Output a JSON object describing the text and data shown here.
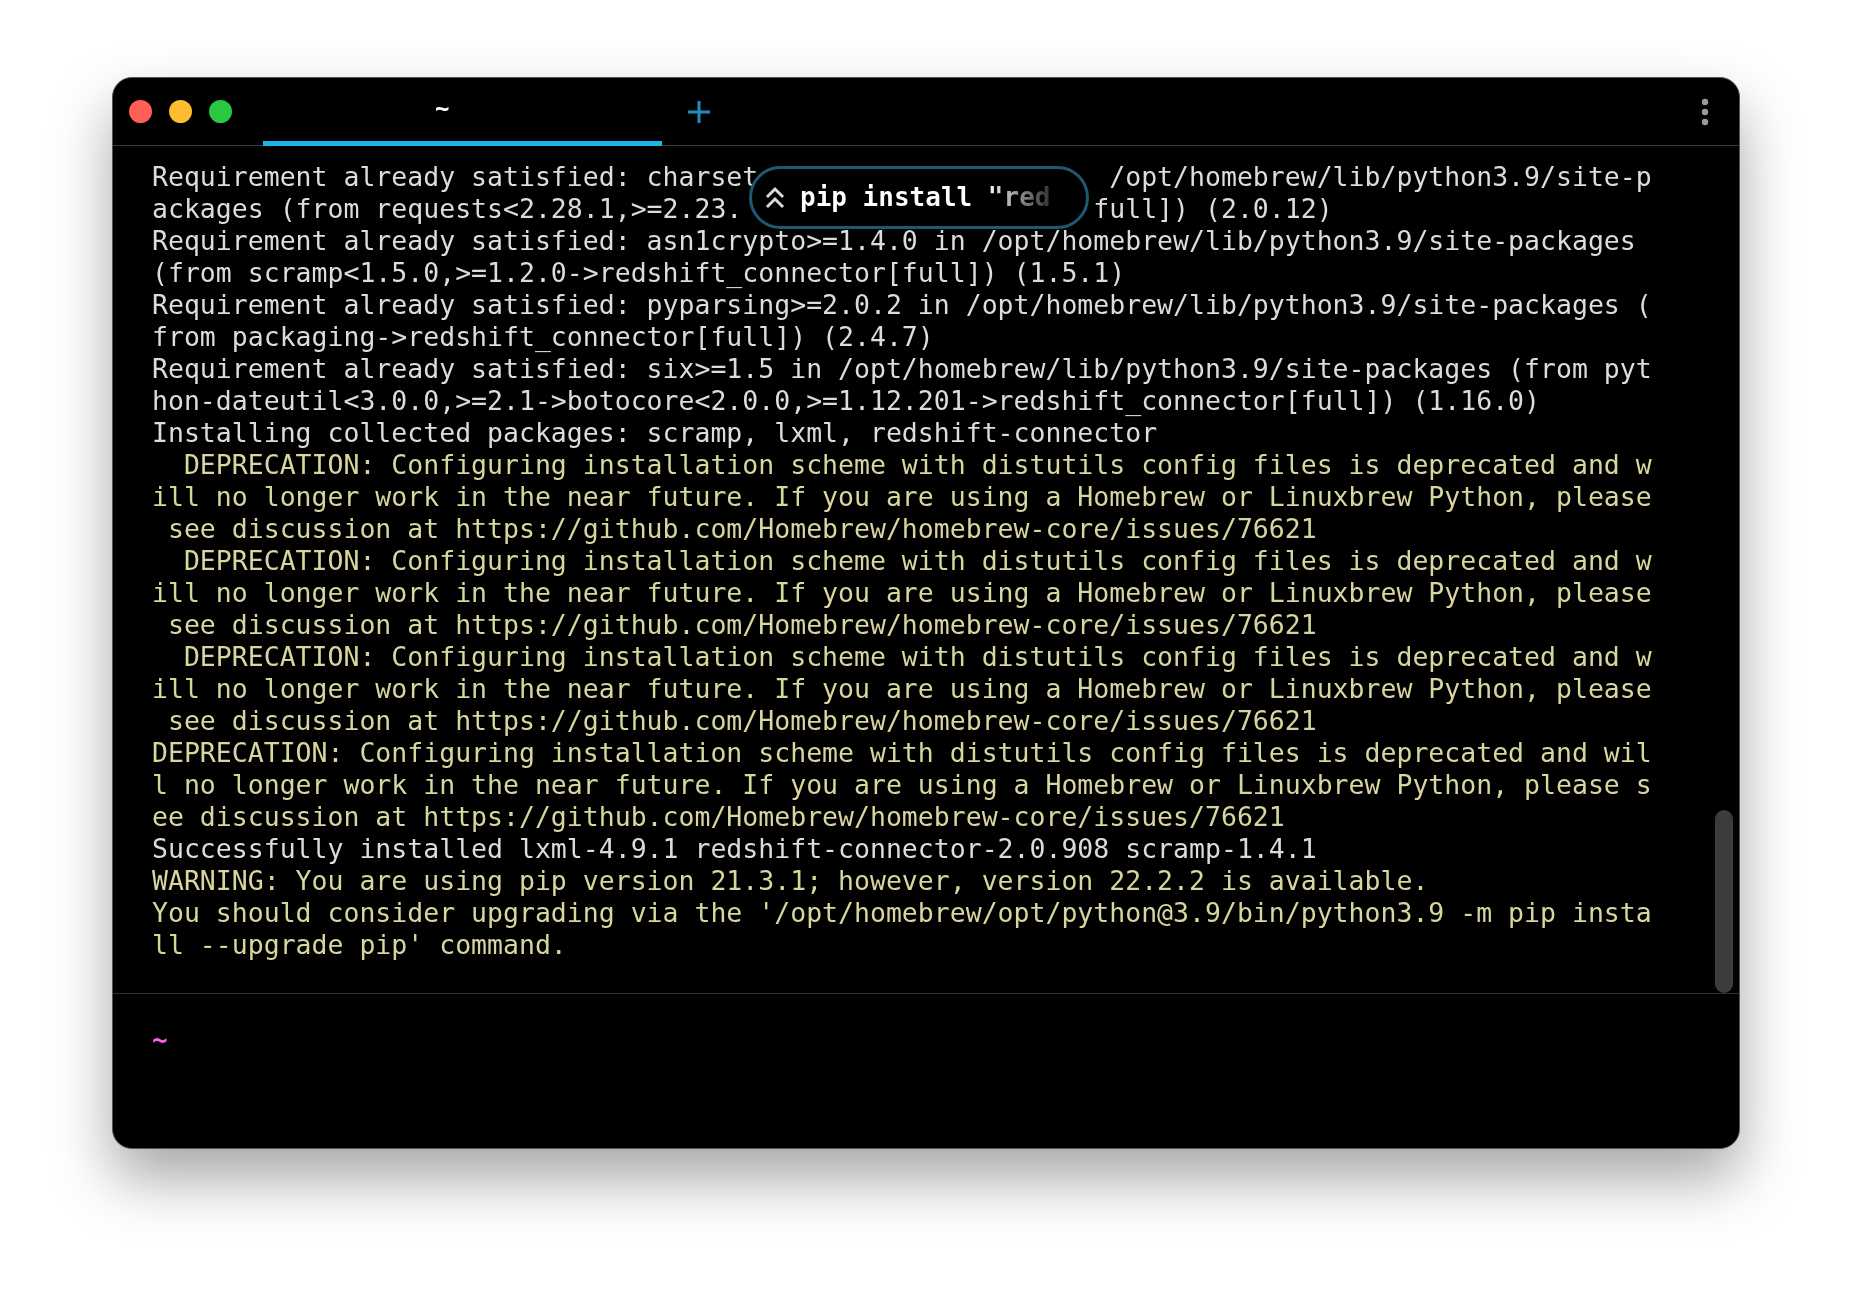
{
  "tab": {
    "title": "~",
    "selected": true
  },
  "output_lines": [
    {
      "kind": "normal",
      "parts": [
        "Requirement already satisfied: charset",
        "/opt/homebrew/lib/python3.9/site-p"
      ]
    },
    {
      "kind": "normal",
      "parts": [
        "ackages (from requests<2.28.1,>=2.23.",
        "full]) (2.0.12)"
      ]
    },
    {
      "kind": "normal",
      "parts": [
        "Requirement already satisfied: asn1crypto>=1.4.0 in /opt/homebrew/lib/python3.9/site-packages"
      ]
    },
    {
      "kind": "normal",
      "parts": [
        "(from scramp<1.5.0,>=1.2.0->redshift_connector[full]) (1.5.1)"
      ]
    },
    {
      "kind": "normal",
      "parts": [
        "Requirement already satisfied: pyparsing>=2.0.2 in /opt/homebrew/lib/python3.9/site-packages ("
      ]
    },
    {
      "kind": "normal",
      "parts": [
        "from packaging->redshift_connector[full]) (2.4.7)"
      ]
    },
    {
      "kind": "normal",
      "parts": [
        "Requirement already satisfied: six>=1.5 in /opt/homebrew/lib/python3.9/site-packages (from pyt"
      ]
    },
    {
      "kind": "normal",
      "parts": [
        "hon-dateutil<3.0.0,>=2.1->botocore<2.0.0,>=1.12.201->redshift_connector[full]) (1.16.0)"
      ]
    },
    {
      "kind": "normal",
      "parts": [
        "Installing collected packages: scramp, lxml, redshift-connector"
      ]
    },
    {
      "kind": "warning",
      "parts": [
        "  DEPRECATION: Configuring installation scheme with distutils config files is deprecated and w"
      ]
    },
    {
      "kind": "warning",
      "parts": [
        "ill no longer work in the near future. If you are using a Homebrew or Linuxbrew Python, please"
      ]
    },
    {
      "kind": "warning",
      "parts": [
        " see discussion at https://github.com/Homebrew/homebrew-core/issues/76621"
      ]
    },
    {
      "kind": "warning",
      "parts": [
        "  DEPRECATION: Configuring installation scheme with distutils config files is deprecated and w"
      ]
    },
    {
      "kind": "warning",
      "parts": [
        "ill no longer work in the near future. If you are using a Homebrew or Linuxbrew Python, please"
      ]
    },
    {
      "kind": "warning",
      "parts": [
        " see discussion at https://github.com/Homebrew/homebrew-core/issues/76621"
      ]
    },
    {
      "kind": "warning",
      "parts": [
        "  DEPRECATION: Configuring installation scheme with distutils config files is deprecated and w"
      ]
    },
    {
      "kind": "warning",
      "parts": [
        "ill no longer work in the near future. If you are using a Homebrew or Linuxbrew Python, please"
      ]
    },
    {
      "kind": "warning",
      "parts": [
        " see discussion at https://github.com/Homebrew/homebrew-core/issues/76621"
      ]
    },
    {
      "kind": "warning",
      "parts": [
        "DEPRECATION: Configuring installation scheme with distutils config files is deprecated and wil"
      ]
    },
    {
      "kind": "warning",
      "parts": [
        "l no longer work in the near future. If you are using a Homebrew or Linuxbrew Python, please s"
      ]
    },
    {
      "kind": "warning",
      "parts": [
        "ee discussion at https://github.com/Homebrew/homebrew-core/issues/76621"
      ]
    },
    {
      "kind": "normal",
      "parts": [
        "Successfully installed lxml-4.9.1 redshift-connector-2.0.908 scramp-1.4.1"
      ]
    },
    {
      "kind": "warning",
      "parts": [
        "WARNING: You are using pip version 21.3.1; however, version 22.2.2 is available."
      ]
    },
    {
      "kind": "warning",
      "parts": [
        "You should consider upgrading via the '/opt/homebrew/opt/python@3.9/bin/python3.9 -m pip insta"
      ]
    },
    {
      "kind": "warning",
      "parts": [
        "ll --upgrade pip' command."
      ]
    }
  ],
  "overlay": {
    "command": "pip install \"red"
  },
  "prompt": {
    "text": "~"
  }
}
